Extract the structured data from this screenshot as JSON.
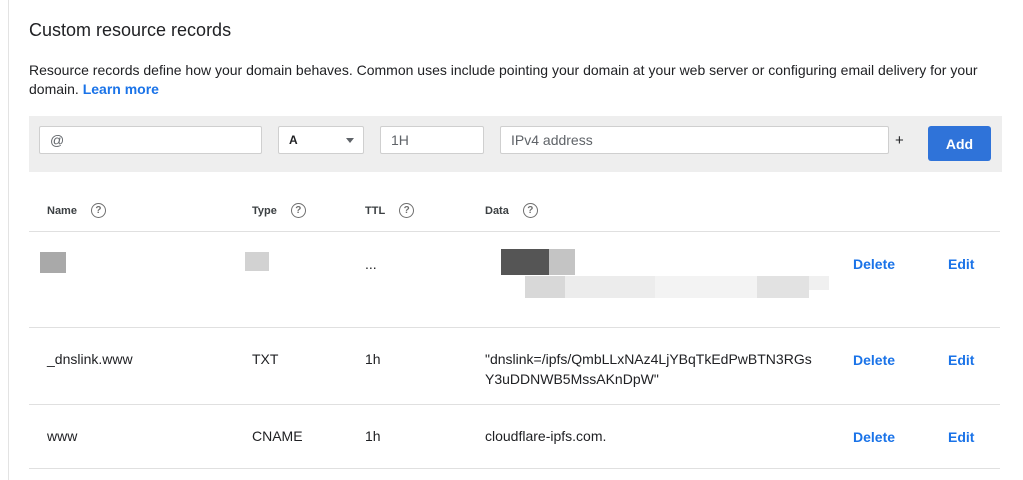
{
  "section": {
    "title": "Custom resource records",
    "description": "Resource records define how your domain behaves. Common uses include pointing your domain at your web server or configuring email delivery for your domain.",
    "learn_more": "Learn more"
  },
  "form": {
    "name_value": "@",
    "type_value": "A",
    "ttl_value": "1H",
    "data_placeholder": "IPv4 address",
    "plus_label": "+",
    "add_label": "Add"
  },
  "table": {
    "headers": [
      "Name",
      "Type",
      "TTL",
      "Data"
    ],
    "help_glyph": "?",
    "rows": [
      {
        "name": "",
        "type": "",
        "ttl": "...",
        "data": "",
        "delete": "Delete",
        "edit": "Edit"
      },
      {
        "name": "_dnslink.www",
        "type": "TXT",
        "ttl": "1h",
        "data": "\"dnslink=/ipfs/QmbLLxNAz4LjYBqTkEdPwBTN3RGs Y3uDDNWB5MssAKnDpW\"",
        "delete": "Delete",
        "edit": "Edit"
      },
      {
        "name": "www",
        "type": "CNAME",
        "ttl": "1h",
        "data": "cloudflare-ipfs.com.",
        "delete": "Delete",
        "edit": "Edit"
      }
    ]
  }
}
